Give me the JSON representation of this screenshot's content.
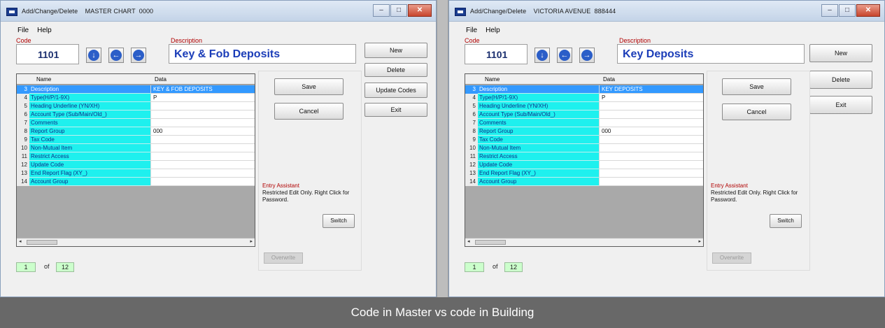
{
  "left_window": {
    "title": "Add/Change/Delete    MASTER CHART  0000",
    "menu": [
      "File",
      "Help"
    ],
    "code_label": "Code",
    "code_value": "1101",
    "description_label": "Description",
    "description_value": "Key & Fob Deposits",
    "buttons": {
      "save": "Save",
      "cancel": "Cancel",
      "new": "New",
      "delete": "Delete",
      "update_codes": "Update Codes",
      "exit": "Exit",
      "switch": "Switch",
      "overwrite": "Overwrite"
    },
    "grid_headers": {
      "name": "Name",
      "data": "Data"
    },
    "rows": [
      {
        "num": "3",
        "name": "Description",
        "data": "KEY & FOB DEPOSITS"
      },
      {
        "num": "4",
        "name": "Type(H/P/1-9X)",
        "data": "P"
      },
      {
        "num": "5",
        "name": "Heading Underline (YN/XH)",
        "data": ""
      },
      {
        "num": "6",
        "name": "Account Type (Sub/Main/Old_)",
        "data": ""
      },
      {
        "num": "7",
        "name": "Comments",
        "data": ""
      },
      {
        "num": "8",
        "name": "Report Group",
        "data": "000"
      },
      {
        "num": "9",
        "name": "Tax Code",
        "data": ""
      },
      {
        "num": "10",
        "name": "Non-Mutual Item",
        "data": ""
      },
      {
        "num": "11",
        "name": "Restrict Access",
        "data": ""
      },
      {
        "num": "12",
        "name": "Update Code",
        "data": ""
      },
      {
        "num": "13",
        "name": "End Report Flag (XY_)",
        "data": ""
      },
      {
        "num": "14",
        "name": "Account Group",
        "data": ""
      }
    ],
    "entry_assistant_label": "Entry Assistant",
    "entry_assistant_text": "Restricted Edit Only. Right Click for Password.",
    "pager": {
      "current": "1",
      "of_label": "of",
      "total": "12"
    }
  },
  "right_window": {
    "title": "Add/Change/Delete    VICTORIA AVENUE  888444",
    "menu": [
      "File",
      "Help"
    ],
    "code_label": "Code",
    "code_value": "1101",
    "description_label": "Description",
    "description_value": "Key Deposits",
    "buttons": {
      "save": "Save",
      "cancel": "Cancel",
      "new": "New",
      "delete": "Delete",
      "exit": "Exit",
      "switch": "Switch",
      "overwrite": "Overwrite"
    },
    "grid_headers": {
      "name": "Name",
      "data": "Data"
    },
    "rows": [
      {
        "num": "3",
        "name": "Description",
        "data": "KEY DEPOSITS"
      },
      {
        "num": "4",
        "name": "Type(H/P/1-9X)",
        "data": "P"
      },
      {
        "num": "5",
        "name": "Heading Underline (YN/XH)",
        "data": ""
      },
      {
        "num": "6",
        "name": "Account Type (Sub/Main/Old_)",
        "data": ""
      },
      {
        "num": "7",
        "name": "Comments",
        "data": ""
      },
      {
        "num": "8",
        "name": "Report Group",
        "data": "000"
      },
      {
        "num": "9",
        "name": "Tax Code",
        "data": ""
      },
      {
        "num": "10",
        "name": "Non-Mutual Item",
        "data": ""
      },
      {
        "num": "11",
        "name": "Restrict Access",
        "data": ""
      },
      {
        "num": "12",
        "name": "Update Code",
        "data": ""
      },
      {
        "num": "13",
        "name": "End Report Flag (XY_)",
        "data": ""
      },
      {
        "num": "14",
        "name": "Account Group",
        "data": ""
      }
    ],
    "entry_assistant_label": "Entry Assistant",
    "entry_assistant_text": "Restricted Edit Only. Right Click for Password.",
    "pager": {
      "current": "1",
      "of_label": "of",
      "total": "12"
    }
  },
  "caption": "Code in Master vs code in Building",
  "icons": {
    "down": "arrow-down-icon",
    "left": "arrow-left-icon",
    "right": "arrow-right-icon"
  },
  "colors": {
    "grid_name_bg": "#1ef0ee",
    "selection": "#3399ff",
    "description_text": "#1b3db8",
    "label_red": "#b00000",
    "caption_bg": "#686868"
  }
}
